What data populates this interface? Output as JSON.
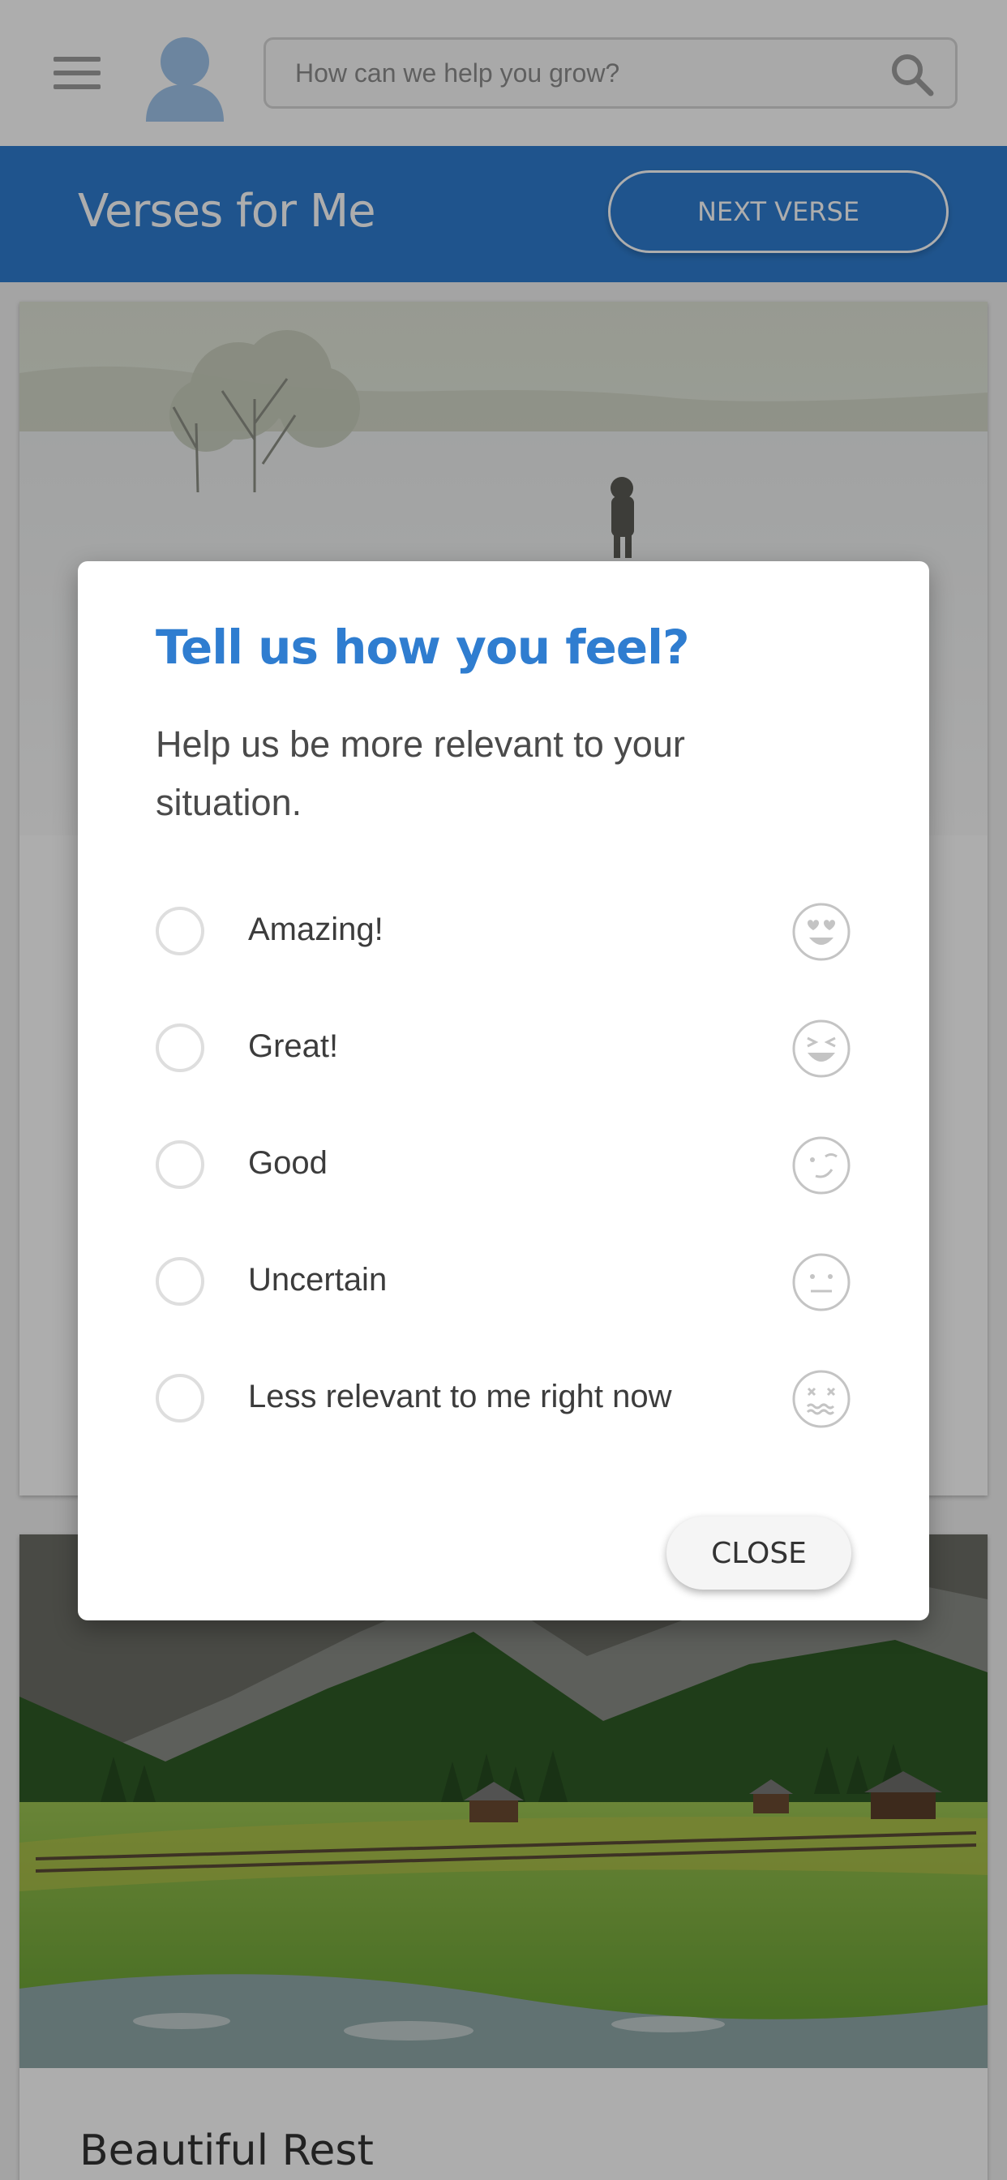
{
  "header": {
    "search_placeholder": "How can we help you grow?"
  },
  "banner": {
    "title": "Verses for Me",
    "next_button": "NEXT VERSE"
  },
  "cards": [
    {
      "image": "snowy-field-photo",
      "title": ""
    },
    {
      "image": "alpine-meadow-photo",
      "title": "Beautiful Rest"
    }
  ],
  "modal": {
    "title": "Tell us how you feel?",
    "subtitle": "Help us be more relevant to your situation.",
    "options": [
      {
        "label": "Amazing!",
        "icon": "heart-eyes-face-icon"
      },
      {
        "label": "Great!",
        "icon": "grinning-squint-face-icon"
      },
      {
        "label": "Good",
        "icon": "winking-face-icon"
      },
      {
        "label": "Uncertain",
        "icon": "neutral-face-icon"
      },
      {
        "label": "Less relevant to me right now",
        "icon": "dizzy-face-icon"
      }
    ],
    "close_label": "CLOSE"
  },
  "colors": {
    "brand_blue": "#2f7dd0",
    "overlay": "rgba(0,0,0,0.32)"
  }
}
